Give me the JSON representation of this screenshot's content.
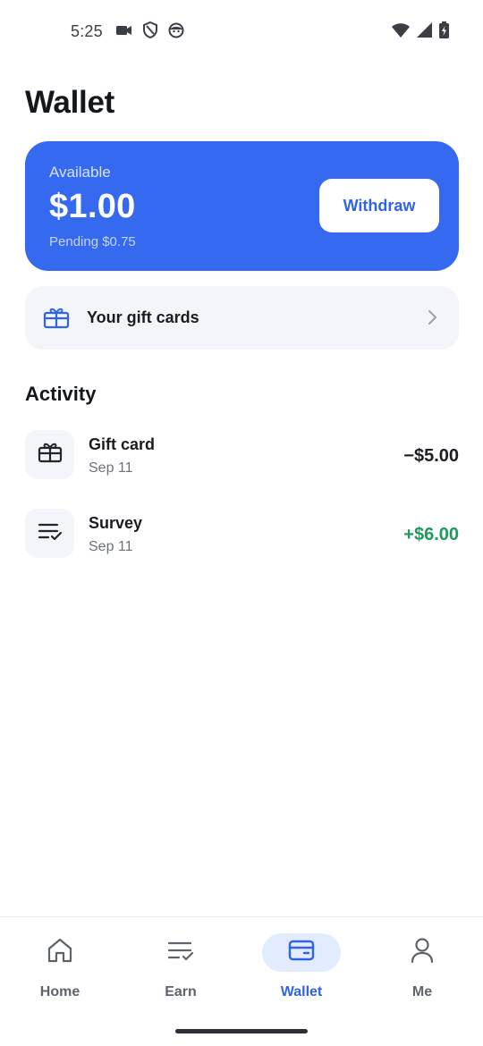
{
  "status_bar": {
    "time": "5:25",
    "icons_left": [
      "video-camera-icon",
      "shield-icon",
      "face-icon"
    ],
    "icons_right": [
      "wifi-icon",
      "signal-icon",
      "battery-charging-icon"
    ]
  },
  "header": {
    "title": "Wallet"
  },
  "balance": {
    "label": "Available",
    "amount": "$1.00",
    "pending": "Pending $0.75",
    "withdraw_label": "Withdraw",
    "card_color": "#3469f0"
  },
  "gift_cards": {
    "label": "Your gift cards",
    "icon": "gift-icon"
  },
  "activity": {
    "title": "Activity",
    "items": [
      {
        "title": "Gift card",
        "date": "Sep 11",
        "amount": "−$5.00",
        "type": "debit",
        "icon": "gift-icon"
      },
      {
        "title": "Survey",
        "date": "Sep 11",
        "amount": "+$6.00",
        "type": "credit",
        "icon": "checklist-icon"
      }
    ]
  },
  "bottom_nav": {
    "items": [
      {
        "label": "Home",
        "icon": "home-icon",
        "active": false
      },
      {
        "label": "Earn",
        "icon": "checklist-icon",
        "active": false
      },
      {
        "label": "Wallet",
        "icon": "wallet-icon",
        "active": true
      },
      {
        "label": "Me",
        "icon": "person-icon",
        "active": false
      }
    ]
  },
  "colors": {
    "accent": "#2f63e8",
    "credit": "#1f9a5e",
    "surface": "#f3f5f9"
  }
}
